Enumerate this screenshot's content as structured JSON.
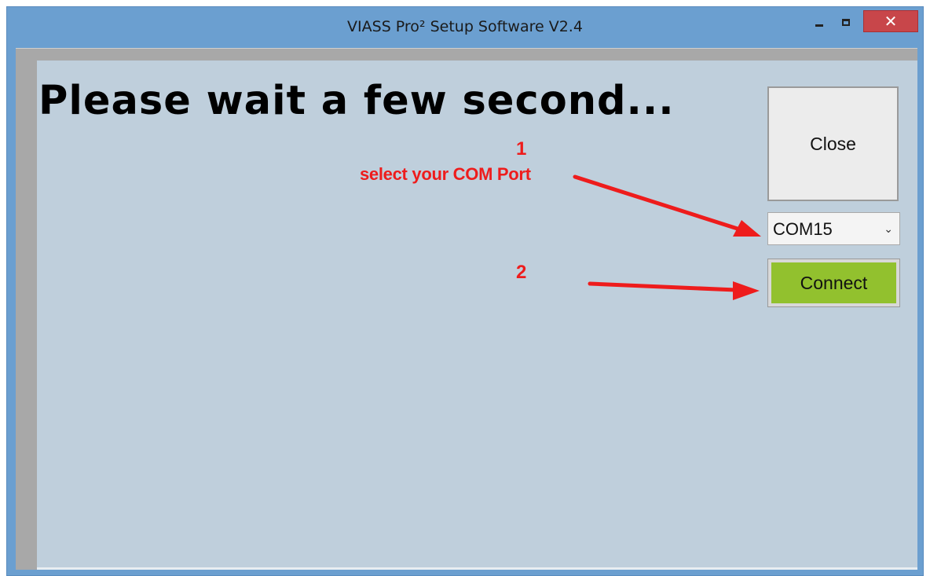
{
  "window": {
    "title": "VIASS Pro²  Setup Software V2.4",
    "close_glyph": "✕"
  },
  "main": {
    "heading": "Please wait a few second...",
    "close_button_label": "Close",
    "com_port": {
      "selected": "COM15"
    },
    "connect_button_label": "Connect"
  },
  "annotations": {
    "step1_number": "1",
    "step1_text": "select your COM Port",
    "step2_number": "2",
    "color": "#ee1c1c"
  },
  "colors": {
    "titlebar": "#6b9fd0",
    "client_bg": "#bfcfdc",
    "connect_green": "#92c12e",
    "close_red": "#c8464a"
  }
}
